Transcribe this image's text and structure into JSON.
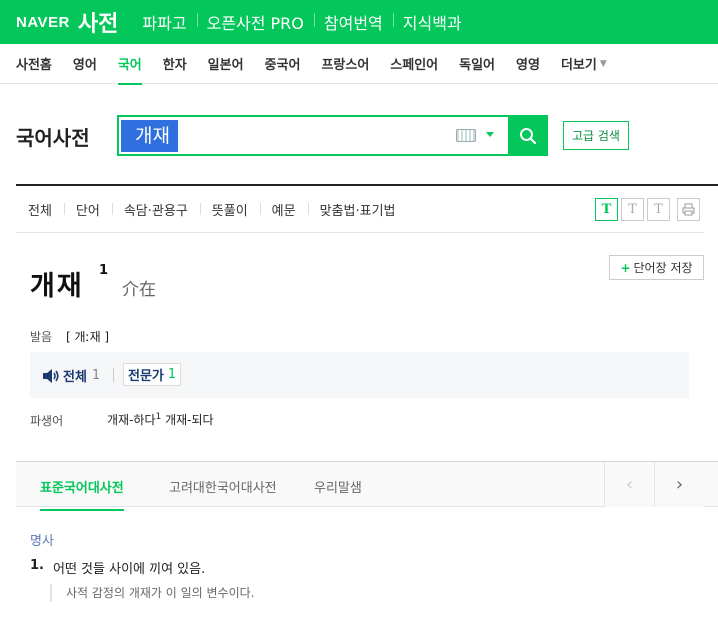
{
  "topbar": {
    "logo": "NAVER",
    "brand": "사전",
    "nav": [
      "파파고",
      "오픈사전 PRO",
      "참여번역",
      "지식백과"
    ]
  },
  "langnav": {
    "items": [
      "사전홈",
      "영어",
      "국어",
      "한자",
      "일본어",
      "중국어",
      "프랑스어",
      "스페인어",
      "독일어",
      "영영",
      "더보기"
    ],
    "active": "국어"
  },
  "search": {
    "dict_title": "국어사전",
    "query": "개재",
    "advanced_label": "고급 검색"
  },
  "filters": {
    "tabs": [
      "전체",
      "단어",
      "속담·관용구",
      "뜻풀이",
      "예문",
      "맞춤법·표기법"
    ],
    "font_buttons": [
      "T",
      "T",
      "T"
    ]
  },
  "entry": {
    "headword": "개재",
    "homonym_number": "1",
    "hanja": "介在",
    "wordbook_label": "단어장 저장",
    "pronunciation_label": "발음",
    "pronunciation": "[ 개ː재 ]",
    "audio": {
      "all_label": "전체",
      "all_count": "1",
      "expert_label": "전문가",
      "expert_count": "1"
    },
    "derivative_label": "파생어",
    "derivatives": [
      {
        "word": "개재-하다",
        "sup": "1"
      },
      {
        "word": "개재-되다",
        "sup": ""
      }
    ]
  },
  "sources": {
    "tabs": [
      "표준국어대사전",
      "고려대한국어대사전",
      "우리말샘"
    ],
    "active": "표준국어대사전"
  },
  "definition": {
    "pos": "명사",
    "number": "1.",
    "text": "어떤 것들 사이에 끼여 있음.",
    "example": "사적 감정의 개재가 이 일의 변수이다."
  }
}
